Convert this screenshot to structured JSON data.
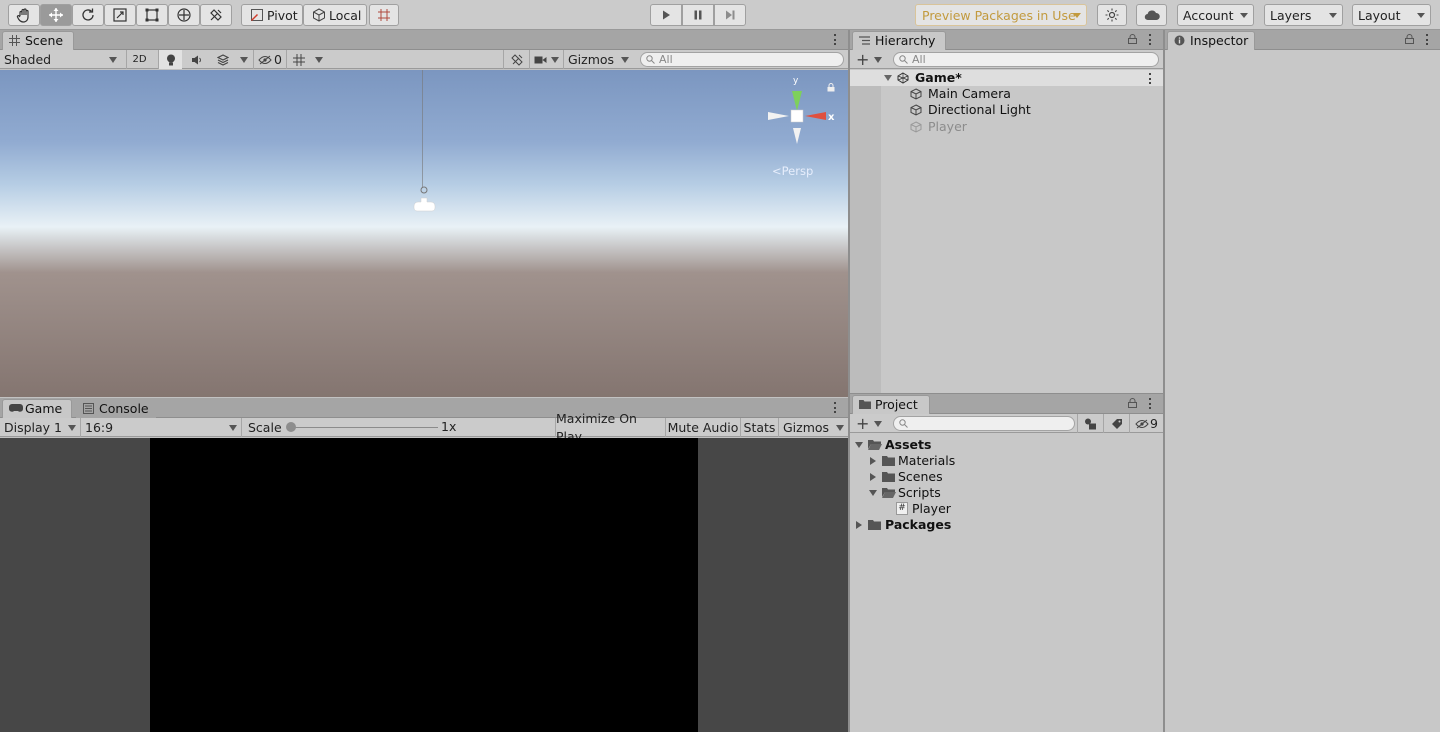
{
  "toolbar": {
    "pivot_label": "Pivot",
    "local_label": "Local",
    "preview_packages_label": "Preview Packages in Use",
    "account_label": "Account",
    "layers_label": "Layers",
    "layout_label": "Layout"
  },
  "scene": {
    "tab_label": "Scene",
    "shading_mode": "Shaded",
    "mode_2d_label": "2D",
    "hidden_count": "0",
    "gizmos_label": "Gizmos",
    "search_placeholder": "All",
    "persp_label": "Persp",
    "gizmo_x_label": "x",
    "gizmo_y_label": "y"
  },
  "game": {
    "tab_label": "Game",
    "console_tab_label": "Console",
    "display_label": "Display 1",
    "aspect_label": "16:9",
    "scale_label": "Scale",
    "scale_value": "1x",
    "maximize_label": "Maximize On Play",
    "mute_label": "Mute Audio",
    "stats_label": "Stats",
    "gizmos_label": "Gizmos"
  },
  "hierarchy": {
    "tab_label": "Hierarchy",
    "search_placeholder": "All",
    "scene_name": "Game*",
    "items": [
      "Main Camera",
      "Directional Light",
      "Player"
    ]
  },
  "project": {
    "tab_label": "Project",
    "hidden_count": "9",
    "tree": {
      "assets": "Assets",
      "materials": "Materials",
      "scenes": "Scenes",
      "scripts": "Scripts",
      "player_script": "Player",
      "packages": "Packages"
    }
  },
  "inspector": {
    "tab_label": "Inspector"
  },
  "colors": {
    "editor_bg": "#c2c2c2",
    "sky_top": "#7d97c2",
    "ground": "#857672",
    "game_view": "#000000",
    "preview_packages_text": "#c29a3e",
    "gizmo_y": "#7ed05c",
    "gizmo_x": "#e0503f"
  }
}
